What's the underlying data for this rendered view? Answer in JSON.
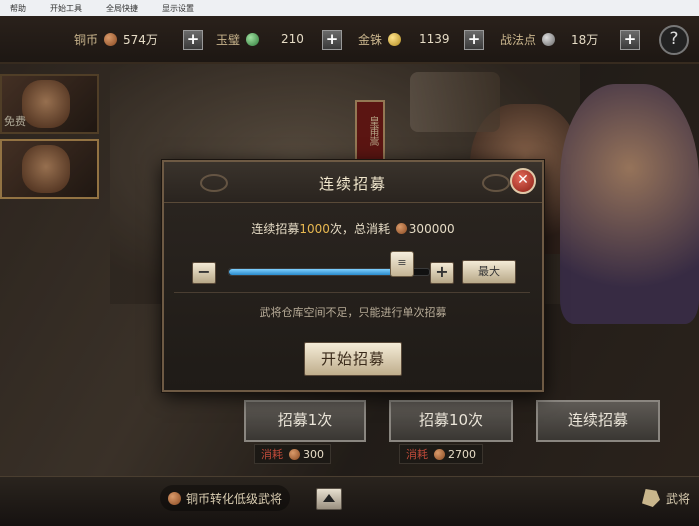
{
  "taskbar": {
    "items": [
      "帮助",
      "开始工具",
      "全局快捷",
      "显示设置"
    ]
  },
  "resources": [
    {
      "label": "铜币",
      "value": "574万",
      "icon": "copper-coin-icon"
    },
    {
      "label": "玉璧",
      "value": "210",
      "icon": "jade-icon"
    },
    {
      "label": "金铢",
      "value": "1139",
      "icon": "gold-coin-icon"
    },
    {
      "label": "战法点",
      "value": "18万",
      "icon": "compass-icon"
    }
  ],
  "help_label": "?",
  "side_cards": [
    {
      "tag": "免费"
    },
    {
      "tag": ""
    }
  ],
  "seal_text": "皇甫嵩",
  "dialog": {
    "title": "连续招募",
    "close": "✕",
    "info_prefix": "连续招募",
    "count": "1000",
    "info_mid": "次，总消耗",
    "total": "300000",
    "minus": "−",
    "plus": "+",
    "max_label": "最大",
    "slider_fraction": 0.86,
    "warning": "武将仓库空间不足，只能进行单次招募",
    "start_label": "开始招募"
  },
  "recruit_buttons": [
    {
      "label": "招募1次",
      "cost_label": "消耗",
      "cost": "300"
    },
    {
      "label": "招募10次",
      "cost_label": "消耗",
      "cost": "2700"
    },
    {
      "label": "连续招募"
    }
  ],
  "bottom": {
    "convert_label": "铜币转化低级武将",
    "right_label": "武将"
  },
  "colors": {
    "accent": "#e8b850",
    "slider": "#2a8acc",
    "close": "#c8372a"
  }
}
